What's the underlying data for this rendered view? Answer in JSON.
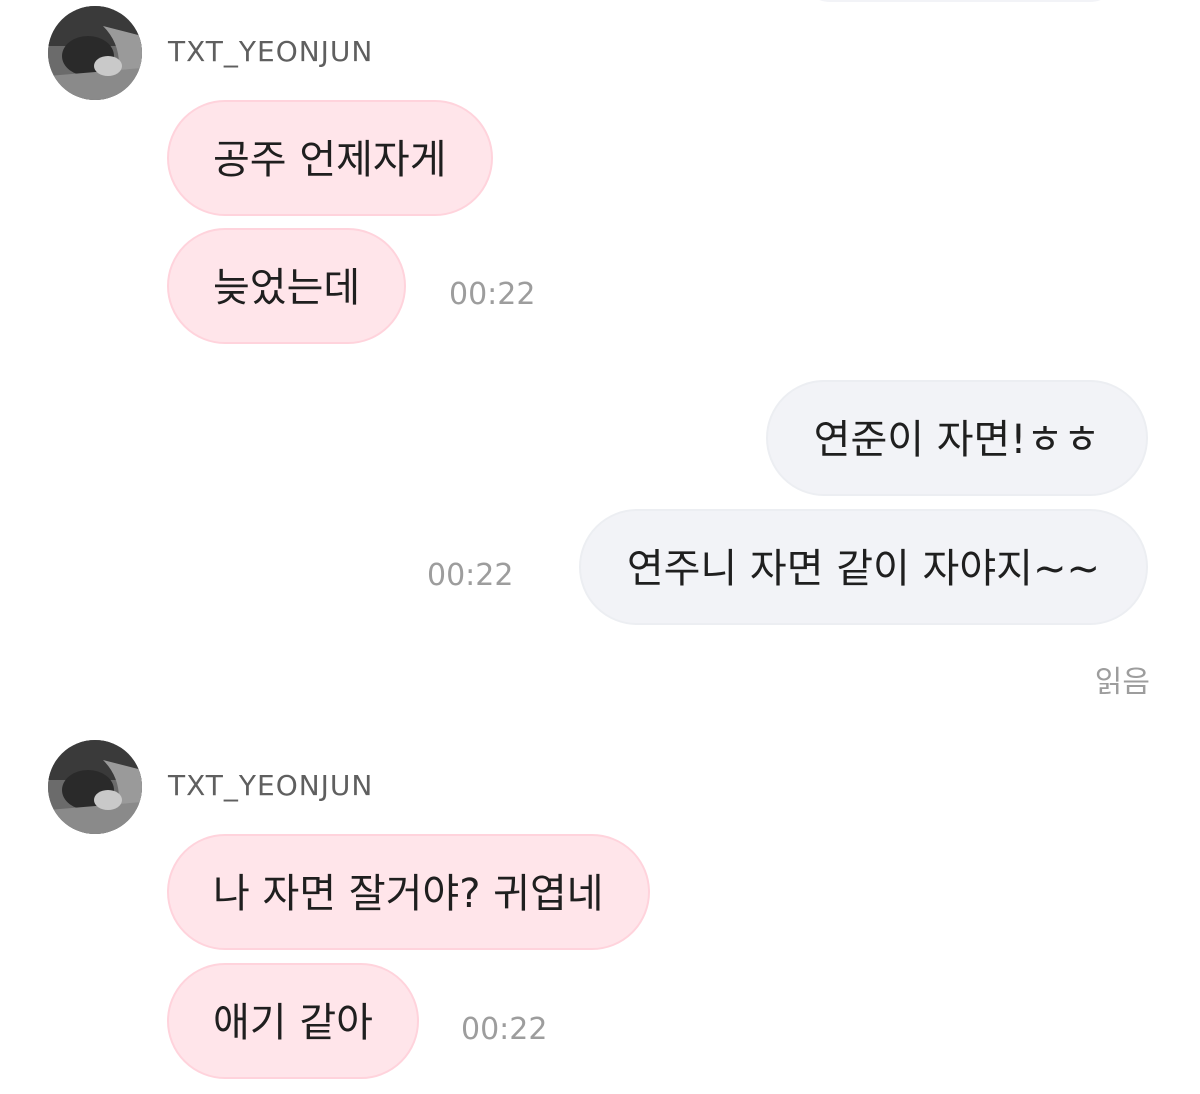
{
  "conversation": {
    "groups": [
      {
        "sender": "TXT_YEONJUN",
        "messages": [
          {
            "text": "공주 언제자게"
          },
          {
            "text": "늦었는데",
            "time": "00:22"
          }
        ]
      },
      {
        "sender": "",
        "messages": [
          {
            "text": "연준이 자면!ㅎㅎ"
          },
          {
            "text": "연주니 자면 같이 자야지~~",
            "time": "00:22"
          }
        ],
        "status": "읽음"
      },
      {
        "sender": "TXT_YEONJUN",
        "messages": [
          {
            "text": "나 자면 잘거야? 귀엽네"
          },
          {
            "text": "애기 같아",
            "time": "00:22"
          }
        ]
      }
    ]
  },
  "colors": {
    "incoming_bubble": "#ffe5ea",
    "outgoing_bubble": "#f2f3f7",
    "timestamp": "#9d9d9d",
    "sender_name": "#5f5f5f"
  }
}
